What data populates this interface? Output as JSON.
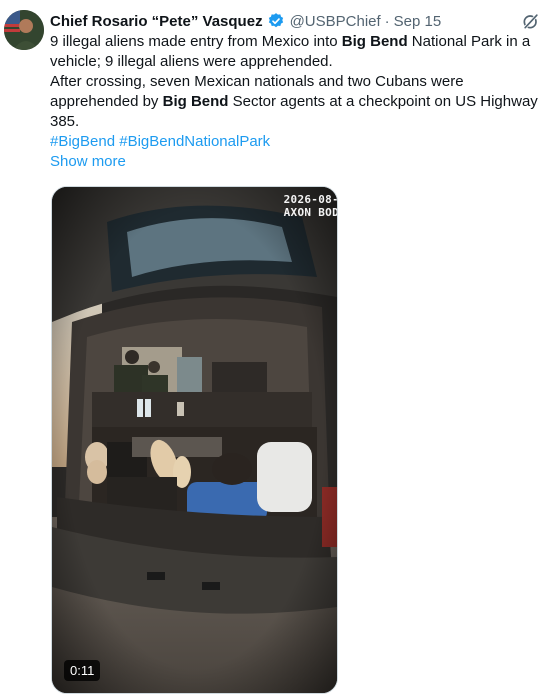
{
  "author": {
    "name": "Chief Rosario “Pete” Vasquez",
    "handle": "@USBPChief",
    "separator": "·",
    "date": "Sep 15"
  },
  "tweet": {
    "line1_a": "9 illegal aliens made entry from Mexico into ",
    "line1_b": "Big Bend",
    "line1_c": " National Park in a vehicle; 9 illegal aliens were apprehended.",
    "line2_a": "After crossing, seven Mexican nationals and two Cubans were apprehended by ",
    "line2_b": "Big Bend",
    "line2_c": " Sector agents at a checkpoint on US Highway 385.",
    "hashtag1": "#BigBend",
    "hashtag2": "#BigBendNationalPark",
    "show_more": "Show more"
  },
  "video": {
    "stamp_line1": "2026-08-",
    "stamp_line2": "AXON BOD",
    "duration": "0:11"
  },
  "colors": {
    "link": "#1d9bf0",
    "secondary_text": "#536471",
    "verified_badge": "#1d9bf0"
  },
  "icons": [
    "verified-badge-icon",
    "grok-icon"
  ]
}
